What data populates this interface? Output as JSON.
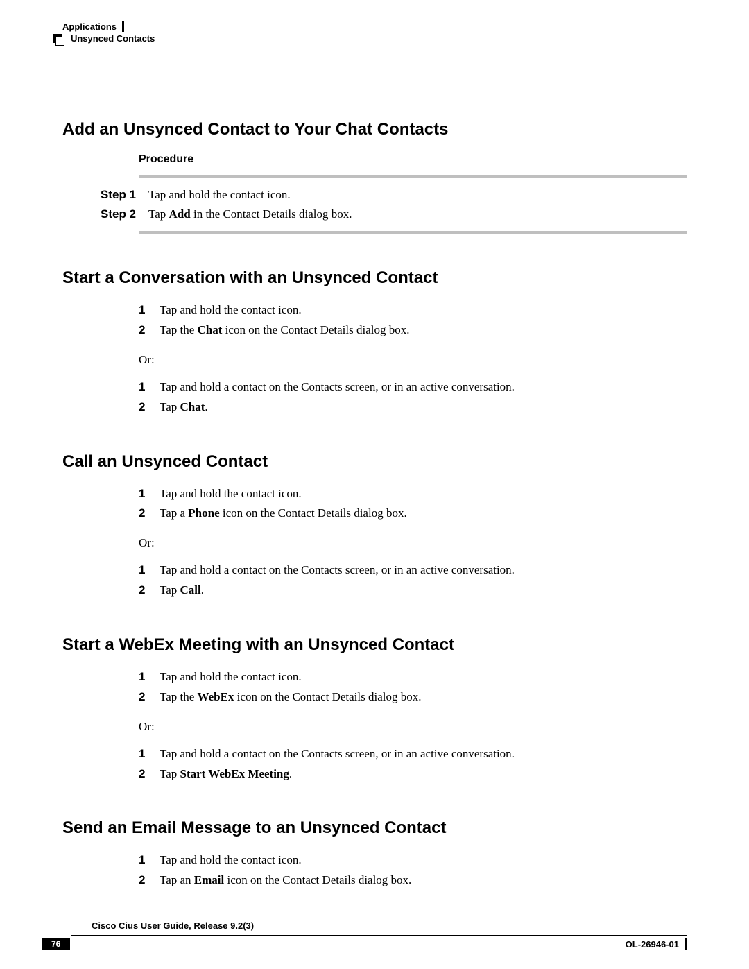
{
  "header": {
    "left": "Unsynced Contacts",
    "right": "Applications"
  },
  "sections": [
    {
      "title": "Add an Unsynced Contact to Your Chat Contacts",
      "procedure_label": "Procedure",
      "steps": [
        {
          "label": "Step 1",
          "parts": [
            "Tap and hold the contact icon."
          ]
        },
        {
          "label": "Step 2",
          "parts": [
            "Tap ",
            {
              "b": "Add"
            },
            " in the Contact Details dialog box."
          ]
        }
      ]
    },
    {
      "title": "Start a Conversation with an Unsynced Contact",
      "list1": [
        {
          "n": "1",
          "parts": [
            "Tap and hold the contact icon."
          ]
        },
        {
          "n": "2",
          "parts": [
            "Tap the ",
            {
              "b": "Chat"
            },
            " icon on the Contact Details dialog box."
          ]
        }
      ],
      "or": "Or:",
      "list2": [
        {
          "n": "1",
          "parts": [
            "Tap and hold a contact on the Contacts screen, or in an active conversation."
          ]
        },
        {
          "n": "2",
          "parts": [
            "Tap ",
            {
              "b": "Chat"
            },
            "."
          ]
        }
      ]
    },
    {
      "title": "Call an Unsynced Contact",
      "list1": [
        {
          "n": "1",
          "parts": [
            "Tap and hold the contact icon."
          ]
        },
        {
          "n": "2",
          "parts": [
            "Tap a ",
            {
              "b": "Phone"
            },
            " icon on the Contact Details dialog box."
          ]
        }
      ],
      "or": "Or:",
      "list2": [
        {
          "n": "1",
          "parts": [
            "Tap and hold a contact on the Contacts screen, or in an active conversation."
          ]
        },
        {
          "n": "2",
          "parts": [
            "Tap ",
            {
              "b": "Call"
            },
            "."
          ]
        }
      ]
    },
    {
      "title": "Start a WebEx Meeting with an Unsynced Contact",
      "list1": [
        {
          "n": "1",
          "parts": [
            "Tap and hold the contact icon."
          ]
        },
        {
          "n": "2",
          "parts": [
            "Tap the ",
            {
              "b": "WebEx"
            },
            " icon on the Contact Details dialog box."
          ]
        }
      ],
      "or": "Or:",
      "list2": [
        {
          "n": "1",
          "parts": [
            "Tap and hold a contact on the Contacts screen, or in an active conversation."
          ]
        },
        {
          "n": "2",
          "parts": [
            "Tap ",
            {
              "b": "Start WebEx Meeting"
            },
            "."
          ]
        }
      ]
    },
    {
      "title": "Send an Email Message to an Unsynced Contact",
      "list1": [
        {
          "n": "1",
          "parts": [
            "Tap and hold the contact icon."
          ]
        },
        {
          "n": "2",
          "parts": [
            "Tap an ",
            {
              "b": "Email"
            },
            " icon on the Contact Details dialog box."
          ]
        }
      ]
    }
  ],
  "footer": {
    "title": "Cisco Cius User Guide, Release 9.2(3)",
    "page": "76",
    "doc_id": "OL-26946-01"
  }
}
